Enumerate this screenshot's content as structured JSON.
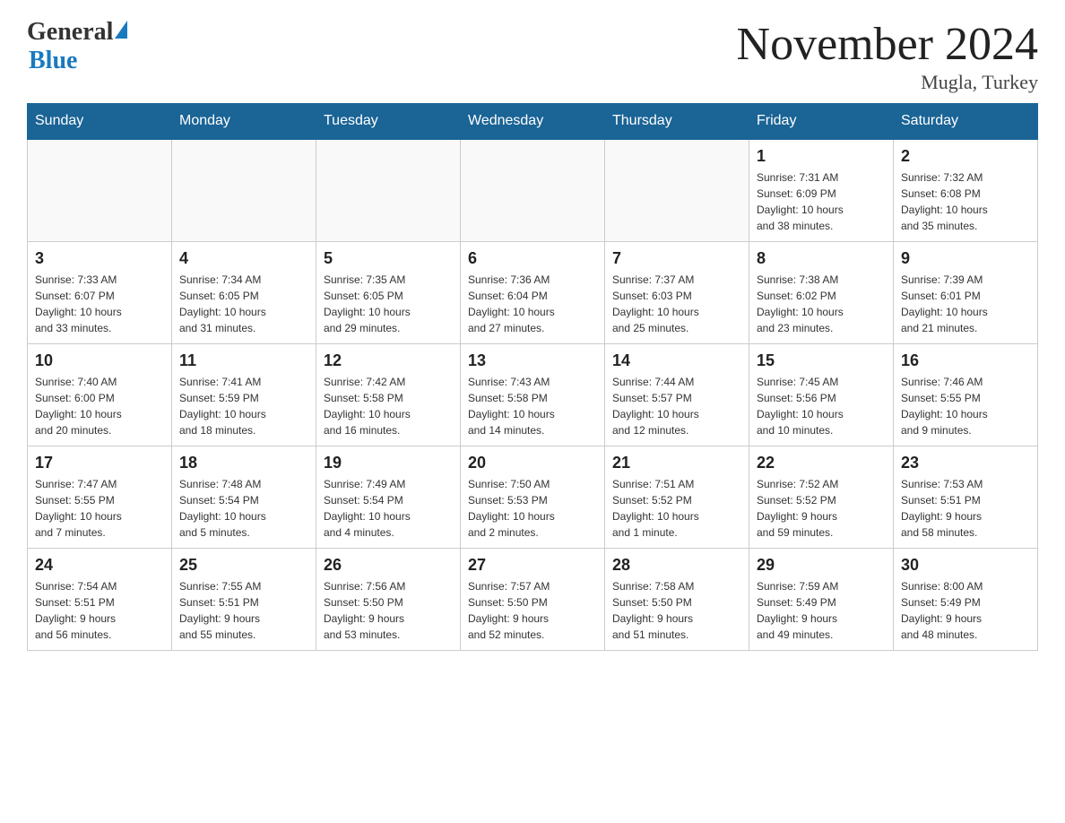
{
  "header": {
    "logo_general": "General",
    "logo_blue": "Blue",
    "month_title": "November 2024",
    "location": "Mugla, Turkey"
  },
  "weekdays": [
    "Sunday",
    "Monday",
    "Tuesday",
    "Wednesday",
    "Thursday",
    "Friday",
    "Saturday"
  ],
  "weeks": [
    [
      {
        "day": "",
        "info": ""
      },
      {
        "day": "",
        "info": ""
      },
      {
        "day": "",
        "info": ""
      },
      {
        "day": "",
        "info": ""
      },
      {
        "day": "",
        "info": ""
      },
      {
        "day": "1",
        "info": "Sunrise: 7:31 AM\nSunset: 6:09 PM\nDaylight: 10 hours\nand 38 minutes."
      },
      {
        "day": "2",
        "info": "Sunrise: 7:32 AM\nSunset: 6:08 PM\nDaylight: 10 hours\nand 35 minutes."
      }
    ],
    [
      {
        "day": "3",
        "info": "Sunrise: 7:33 AM\nSunset: 6:07 PM\nDaylight: 10 hours\nand 33 minutes."
      },
      {
        "day": "4",
        "info": "Sunrise: 7:34 AM\nSunset: 6:05 PM\nDaylight: 10 hours\nand 31 minutes."
      },
      {
        "day": "5",
        "info": "Sunrise: 7:35 AM\nSunset: 6:05 PM\nDaylight: 10 hours\nand 29 minutes."
      },
      {
        "day": "6",
        "info": "Sunrise: 7:36 AM\nSunset: 6:04 PM\nDaylight: 10 hours\nand 27 minutes."
      },
      {
        "day": "7",
        "info": "Sunrise: 7:37 AM\nSunset: 6:03 PM\nDaylight: 10 hours\nand 25 minutes."
      },
      {
        "day": "8",
        "info": "Sunrise: 7:38 AM\nSunset: 6:02 PM\nDaylight: 10 hours\nand 23 minutes."
      },
      {
        "day": "9",
        "info": "Sunrise: 7:39 AM\nSunset: 6:01 PM\nDaylight: 10 hours\nand 21 minutes."
      }
    ],
    [
      {
        "day": "10",
        "info": "Sunrise: 7:40 AM\nSunset: 6:00 PM\nDaylight: 10 hours\nand 20 minutes."
      },
      {
        "day": "11",
        "info": "Sunrise: 7:41 AM\nSunset: 5:59 PM\nDaylight: 10 hours\nand 18 minutes."
      },
      {
        "day": "12",
        "info": "Sunrise: 7:42 AM\nSunset: 5:58 PM\nDaylight: 10 hours\nand 16 minutes."
      },
      {
        "day": "13",
        "info": "Sunrise: 7:43 AM\nSunset: 5:58 PM\nDaylight: 10 hours\nand 14 minutes."
      },
      {
        "day": "14",
        "info": "Sunrise: 7:44 AM\nSunset: 5:57 PM\nDaylight: 10 hours\nand 12 minutes."
      },
      {
        "day": "15",
        "info": "Sunrise: 7:45 AM\nSunset: 5:56 PM\nDaylight: 10 hours\nand 10 minutes."
      },
      {
        "day": "16",
        "info": "Sunrise: 7:46 AM\nSunset: 5:55 PM\nDaylight: 10 hours\nand 9 minutes."
      }
    ],
    [
      {
        "day": "17",
        "info": "Sunrise: 7:47 AM\nSunset: 5:55 PM\nDaylight: 10 hours\nand 7 minutes."
      },
      {
        "day": "18",
        "info": "Sunrise: 7:48 AM\nSunset: 5:54 PM\nDaylight: 10 hours\nand 5 minutes."
      },
      {
        "day": "19",
        "info": "Sunrise: 7:49 AM\nSunset: 5:54 PM\nDaylight: 10 hours\nand 4 minutes."
      },
      {
        "day": "20",
        "info": "Sunrise: 7:50 AM\nSunset: 5:53 PM\nDaylight: 10 hours\nand 2 minutes."
      },
      {
        "day": "21",
        "info": "Sunrise: 7:51 AM\nSunset: 5:52 PM\nDaylight: 10 hours\nand 1 minute."
      },
      {
        "day": "22",
        "info": "Sunrise: 7:52 AM\nSunset: 5:52 PM\nDaylight: 9 hours\nand 59 minutes."
      },
      {
        "day": "23",
        "info": "Sunrise: 7:53 AM\nSunset: 5:51 PM\nDaylight: 9 hours\nand 58 minutes."
      }
    ],
    [
      {
        "day": "24",
        "info": "Sunrise: 7:54 AM\nSunset: 5:51 PM\nDaylight: 9 hours\nand 56 minutes."
      },
      {
        "day": "25",
        "info": "Sunrise: 7:55 AM\nSunset: 5:51 PM\nDaylight: 9 hours\nand 55 minutes."
      },
      {
        "day": "26",
        "info": "Sunrise: 7:56 AM\nSunset: 5:50 PM\nDaylight: 9 hours\nand 53 minutes."
      },
      {
        "day": "27",
        "info": "Sunrise: 7:57 AM\nSunset: 5:50 PM\nDaylight: 9 hours\nand 52 minutes."
      },
      {
        "day": "28",
        "info": "Sunrise: 7:58 AM\nSunset: 5:50 PM\nDaylight: 9 hours\nand 51 minutes."
      },
      {
        "day": "29",
        "info": "Sunrise: 7:59 AM\nSunset: 5:49 PM\nDaylight: 9 hours\nand 49 minutes."
      },
      {
        "day": "30",
        "info": "Sunrise: 8:00 AM\nSunset: 5:49 PM\nDaylight: 9 hours\nand 48 minutes."
      }
    ]
  ]
}
